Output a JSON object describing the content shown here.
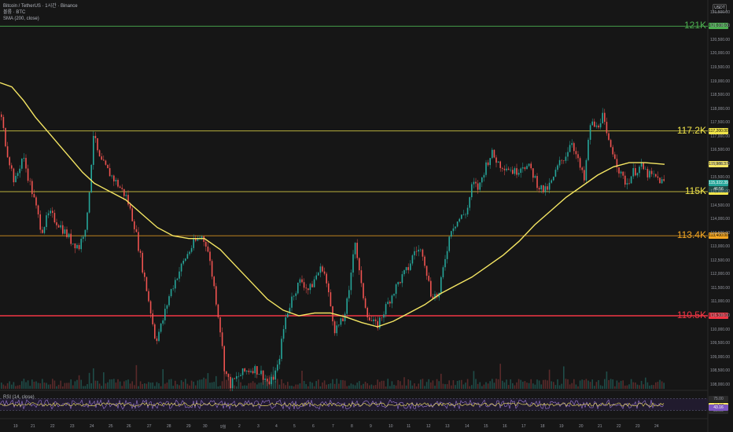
{
  "header": {
    "title": "Bitcoin / TetherUS · 1시간 · Binance",
    "volume_label": "볼륨 · BTC",
    "sma_label": "SMA (200, close)"
  },
  "currency_button": "USDT",
  "hlines": [
    {
      "label": "121K",
      "tag": "121,000.00",
      "color": "#4caf50",
      "price": 121000
    },
    {
      "label": "117.2K",
      "tag": "117,200.00",
      "color": "#f0e44a",
      "price": 117200
    },
    {
      "label": "115K",
      "tag": "115,000.00",
      "color": "#f0e44a",
      "price": 115000
    },
    {
      "label": "113.4K",
      "tag": "113,400.00",
      "color": "#f5a623",
      "price": 113400
    },
    {
      "label": "110.5K",
      "tag": "110,500.00",
      "color": "#f23645",
      "price": 110500
    }
  ],
  "sma_tag": {
    "text": "115,986.37",
    "price": 115986
  },
  "last_price_tag": {
    "text": "115,322.39",
    "sub": "46:56",
    "price": 115322
  },
  "y_axis": [
    "121,500.00",
    "121,000.00",
    "120,500.00",
    "120,000.00",
    "119,500.00",
    "119,000.00",
    "118,500.00",
    "118,000.00",
    "117,500.00",
    "117,000.00",
    "116,500.00",
    "116,000.00",
    "115,500.00",
    "115,000.00",
    "114,500.00",
    "114,000.00",
    "113,500.00",
    "113,000.00",
    "112,500.00",
    "112,000.00",
    "111,500.00",
    "111,000.00",
    "110,500.00",
    "110,000.00",
    "109,500.00",
    "109,000.00",
    "108,500.00",
    "108,000.00"
  ],
  "x_axis": [
    "19",
    "21",
    "22",
    "23",
    "24",
    "25",
    "26",
    "27",
    "28",
    "29",
    "30",
    "9월",
    "2",
    "3",
    "4",
    "5",
    "6",
    "7",
    "8",
    "9",
    "10",
    "11",
    "12",
    "13",
    "14",
    "15",
    "16",
    "17",
    "18",
    "19",
    "20",
    "21",
    "22",
    "23",
    "24"
  ],
  "rsi": {
    "label": "RSI (14, close)",
    "levels": [
      "75.00",
      "25.00"
    ],
    "tag1": "44.37",
    "tag2": "43.16"
  },
  "colors": {
    "up": "#26a69a",
    "down": "#ef5350",
    "sma": "#f5e663",
    "background": "#161616"
  }
}
